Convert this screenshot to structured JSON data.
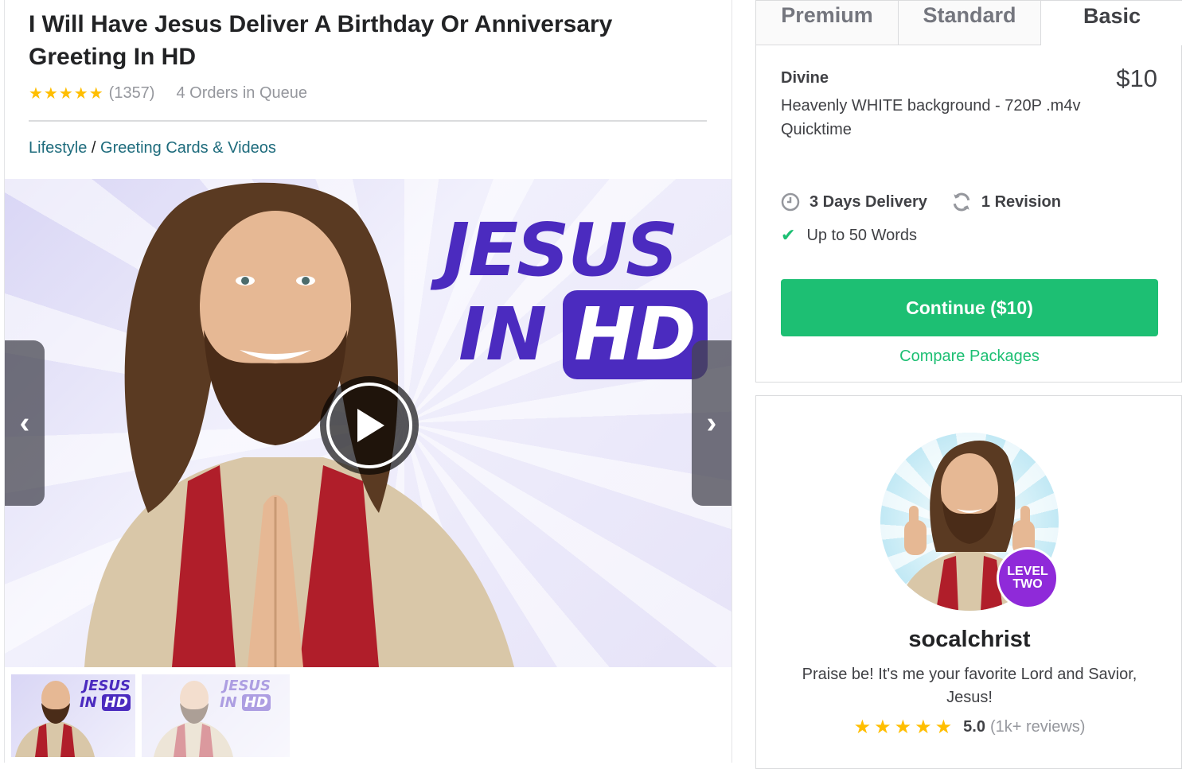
{
  "gig": {
    "title": "I Will Have Jesus Deliver A Birthday Or Anniversary Greeting In HD",
    "stars": "★★★★★",
    "rating_count": "(1357)",
    "queue": "4 Orders in Queue",
    "breadcrumb": {
      "category": "Lifestyle",
      "separator": " / ",
      "subcategory": "Greeting Cards & Videos"
    }
  },
  "gallery": {
    "logo_line1": "JESUS",
    "logo_line2_prefix": "IN",
    "logo_hd": "HD",
    "prev_label": "‹",
    "next_label": "›"
  },
  "thumbnails": [
    {
      "line1": "JESUS",
      "line2": "IN",
      "hd": "HD"
    },
    {
      "line1": "JESUS",
      "line2": "IN",
      "hd": "HD"
    }
  ],
  "package": {
    "tabs": [
      "Premium",
      "Standard",
      "Basic"
    ],
    "active_tab": "Basic",
    "name": "Divine",
    "price": "$10",
    "description": "Heavenly WHITE background - 720P .m4v Quicktime",
    "delivery": "3 Days Delivery",
    "revisions": "1 Revision",
    "included": "Up to 50 Words",
    "continue_label": "Continue ($10)",
    "compare_label": "Compare Packages"
  },
  "seller": {
    "username": "socalchrist",
    "level_line1": "LEVEL",
    "level_line2": "TWO",
    "tagline": "Praise be! It's me your favorite Lord and Savior, Jesus!",
    "stars": "★★★★★",
    "score": "5.0",
    "reviews": "(1k+ reviews)"
  },
  "colors": {
    "accent_green": "#1dbf73",
    "star": "#ffbe00",
    "level_badge": "#8f2ad9",
    "logo_purple": "#4b2bbf"
  }
}
